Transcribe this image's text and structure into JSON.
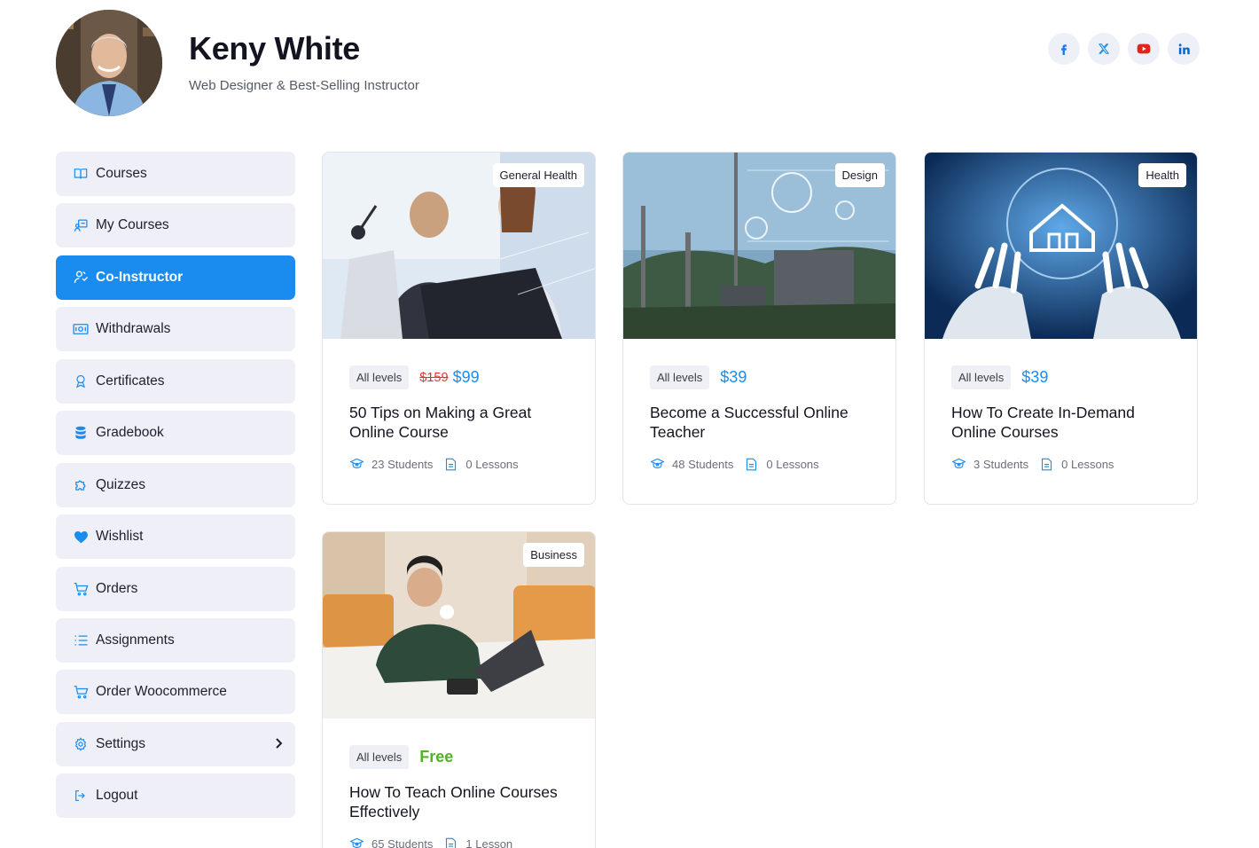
{
  "profile": {
    "name": "Keny White",
    "role": "Web Designer & Best-Selling Instructor"
  },
  "socials": [
    {
      "icon": "facebook-icon",
      "color": "#1877f2"
    },
    {
      "icon": "x-icon",
      "color": "#1a8cf0"
    },
    {
      "icon": "youtube-icon",
      "color": "#e5231b"
    },
    {
      "icon": "linkedin-icon",
      "color": "#0a66c2"
    }
  ],
  "sidebar": {
    "accent": "#1a8cf0",
    "items": [
      {
        "label": "Courses",
        "icon": "book-icon"
      },
      {
        "label": "My Courses",
        "icon": "my-courses-icon"
      },
      {
        "label": "Co-Instructor",
        "icon": "co-instructor-icon",
        "active": true
      },
      {
        "label": "Withdrawals",
        "icon": "money-icon"
      },
      {
        "label": "Certificates",
        "icon": "certificate-icon"
      },
      {
        "label": "Gradebook",
        "icon": "database-icon"
      },
      {
        "label": "Quizzes",
        "icon": "puzzle-icon"
      },
      {
        "label": "Wishlist",
        "icon": "heart-icon"
      },
      {
        "label": "Orders",
        "icon": "cart-icon"
      },
      {
        "label": "Assignments",
        "icon": "list-icon"
      },
      {
        "label": "Order Woocommerce",
        "icon": "cart-icon"
      },
      {
        "label": "Settings",
        "icon": "gear-icon",
        "has_submenu": true
      },
      {
        "label": "Logout",
        "icon": "logout-icon"
      }
    ]
  },
  "courses": [
    {
      "category": "General Health",
      "level": "All levels",
      "old_price": "$159",
      "price": "$99",
      "title": "50 Tips on Making a Great Online Course",
      "students": "23 Students",
      "lessons": "0 Lessons"
    },
    {
      "category": "Design",
      "level": "All levels",
      "price": "$39",
      "title": "Become a Successful Online Teacher",
      "students": "48 Students",
      "lessons": "0 Lessons"
    },
    {
      "category": "Health",
      "level": "All levels",
      "price": "$39",
      "title": "How To Create In-Demand Online Courses",
      "students": "3 Students",
      "lessons": "0 Lessons"
    },
    {
      "category": "Business",
      "level": "All levels",
      "price": "Free",
      "title": "How To Teach Online Courses Effectively",
      "students": "65 Students",
      "lessons": "1 Lesson"
    }
  ]
}
